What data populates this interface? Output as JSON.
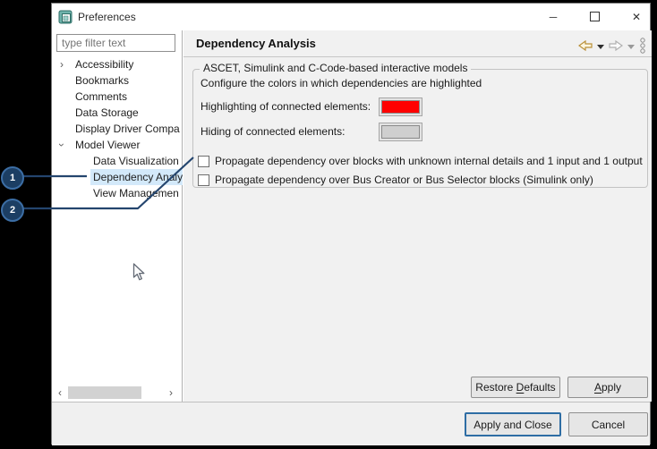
{
  "window": {
    "title": "Preferences"
  },
  "icons": {
    "minimize_glyph": "─",
    "close_glyph": "✕",
    "chevron_glyph": "›",
    "scroll_left_glyph": "‹",
    "scroll_right_glyph": "›"
  },
  "sidebar": {
    "filter_placeholder": "type filter text",
    "tree": [
      {
        "label": "Accessibility",
        "level": 0,
        "expander": "collapsed",
        "selected": false
      },
      {
        "label": "Bookmarks",
        "level": 0,
        "expander": null,
        "selected": false
      },
      {
        "label": "Comments",
        "level": 0,
        "expander": null,
        "selected": false
      },
      {
        "label": "Data Storage",
        "level": 0,
        "expander": null,
        "selected": false
      },
      {
        "label": "Display Driver Compa",
        "level": 0,
        "expander": null,
        "selected": false
      },
      {
        "label": "Model Viewer",
        "level": 0,
        "expander": "expanded",
        "selected": false
      },
      {
        "label": "Data Visualization",
        "level": 1,
        "expander": null,
        "selected": false
      },
      {
        "label": "Dependency Analy",
        "level": 1,
        "expander": null,
        "selected": true
      },
      {
        "label": "View Managemen",
        "level": 1,
        "expander": null,
        "selected": false
      }
    ]
  },
  "main": {
    "title": "Dependency Analysis",
    "group": {
      "label": "ASCET, Simulink and C-Code-based interactive models",
      "description": "Configure the colors in which dependencies are highlighted",
      "color_rows": [
        {
          "label": "Highlighting of connected elements:",
          "color": "#ff0000"
        },
        {
          "label": "Hiding of connected elements:",
          "color": "#cfcfcf"
        }
      ],
      "checkboxes": [
        {
          "label": "Propagate dependency over blocks with unknown internal details and 1 input and 1 output",
          "checked": false
        },
        {
          "label": "Propagate dependency over Bus Creator or Bus Selector blocks (Simulink only)",
          "checked": false
        }
      ]
    },
    "buttons": {
      "restore_defaults": {
        "pre": "Restore ",
        "key": "D",
        "post": "efaults"
      },
      "apply": {
        "pre": "",
        "key": "A",
        "post": "pply"
      }
    }
  },
  "footer": {
    "apply_and_close": "Apply and Close",
    "cancel": "Cancel"
  },
  "callouts": [
    {
      "number": "1"
    },
    {
      "number": "2"
    }
  ],
  "colors": {
    "highlight_swatch": "#ff0000",
    "hide_swatch": "#cfcfcf",
    "tree_selection": "#d3e9fa",
    "badge_fill": "#1c3e63",
    "default_button_border": "#2e6da4",
    "back_arrow_gold": "#b99039"
  }
}
